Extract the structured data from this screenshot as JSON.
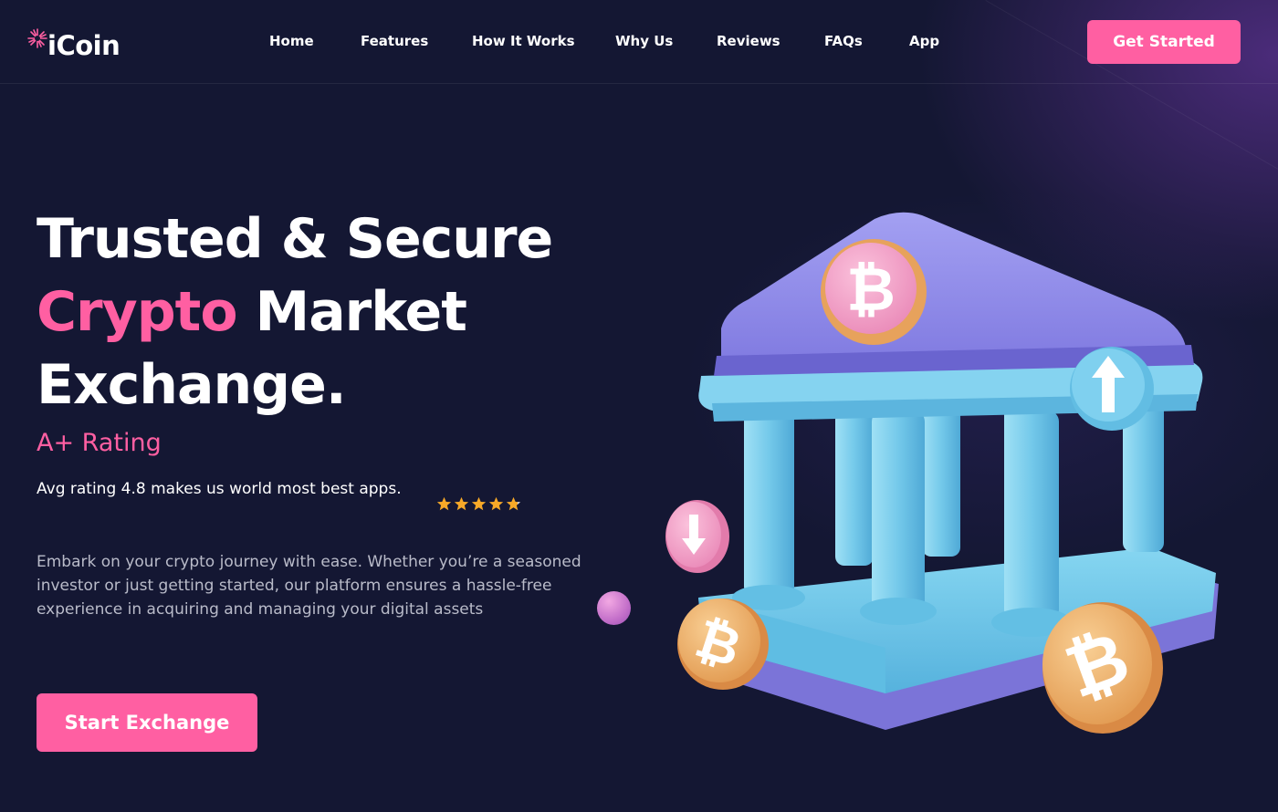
{
  "brand": {
    "name": "iCoin",
    "logo_icon": "starburst-icon"
  },
  "nav": {
    "links": [
      "Home",
      "Features",
      "How It Works",
      "Why Us",
      "Reviews",
      "FAQs",
      "App"
    ],
    "cta_label": "Get Started"
  },
  "hero": {
    "headline_line1": "Trusted & Secure",
    "headline_accent": "Crypto",
    "headline_line2_rest": " Market",
    "headline_line3": "Exchange.",
    "rating_title": "A+ Rating",
    "rating_text": "Avg rating 4.8 makes us world most best apps.",
    "rating_value": 4.8,
    "rating_max": 5,
    "description": "Embark on your crypto journey with ease. Whether you’re a seasoned investor or just getting started, our platform ensures a hassle-free experience in acquiring and managing your digital assets",
    "cta_label": "Start Exchange"
  },
  "illustration": {
    "subject": "bank-building-icon",
    "coin_symbol": "₿",
    "arrow_up_icon": "arrow-up-icon",
    "arrow_down_icon": "arrow-down-icon"
  },
  "colors": {
    "background": "#141733",
    "accent": "#ff5fa2",
    "text": "#ffffff",
    "muted_text": "#b9bbc9",
    "star": "#f7a928",
    "roof": "#8b86e6",
    "pillar": "#72c8e8",
    "coin": "#f0b574"
  }
}
